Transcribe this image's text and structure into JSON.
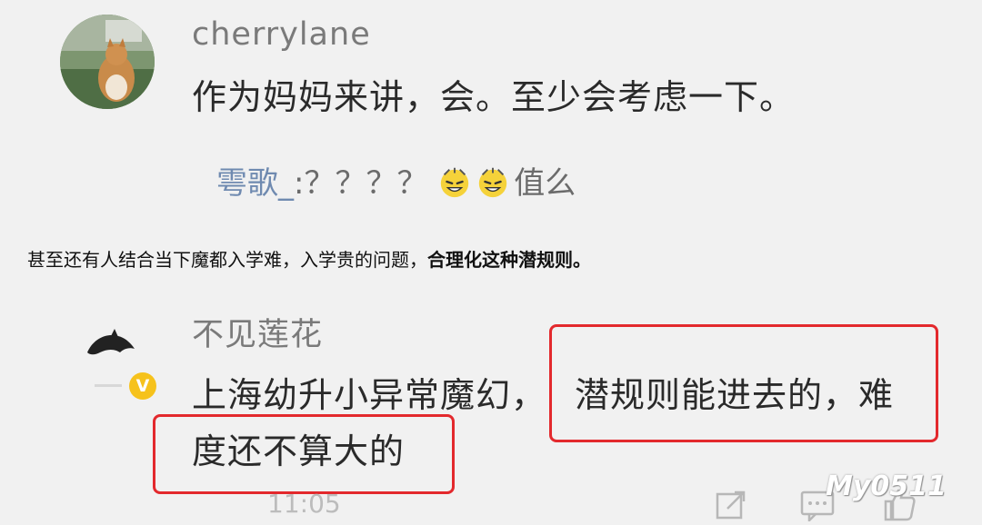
{
  "comment1": {
    "username": "cherrylane",
    "text": "作为妈妈来讲，会。至少会考虑一下。",
    "reply": {
      "name": "雩歌_",
      "text": ":？？？？",
      "suffix": "值么"
    }
  },
  "caption": {
    "normal": "甚至还有人结合当下魔都入学难，入学贵的问题，",
    "bold": "合理化这种潜规则。"
  },
  "comment2": {
    "username": "不见莲花",
    "line1_part1": "上海幼升小异常魔幻，",
    "line1_part2": "潜规则能进去的，难",
    "line2": "度还不算大的",
    "badge": "V",
    "timestamp": "11:05"
  },
  "watermark": "My0511",
  "colors": {
    "highlight_border": "#e3292d",
    "background": "#f1f1f1",
    "badge": "#f6c21c"
  }
}
